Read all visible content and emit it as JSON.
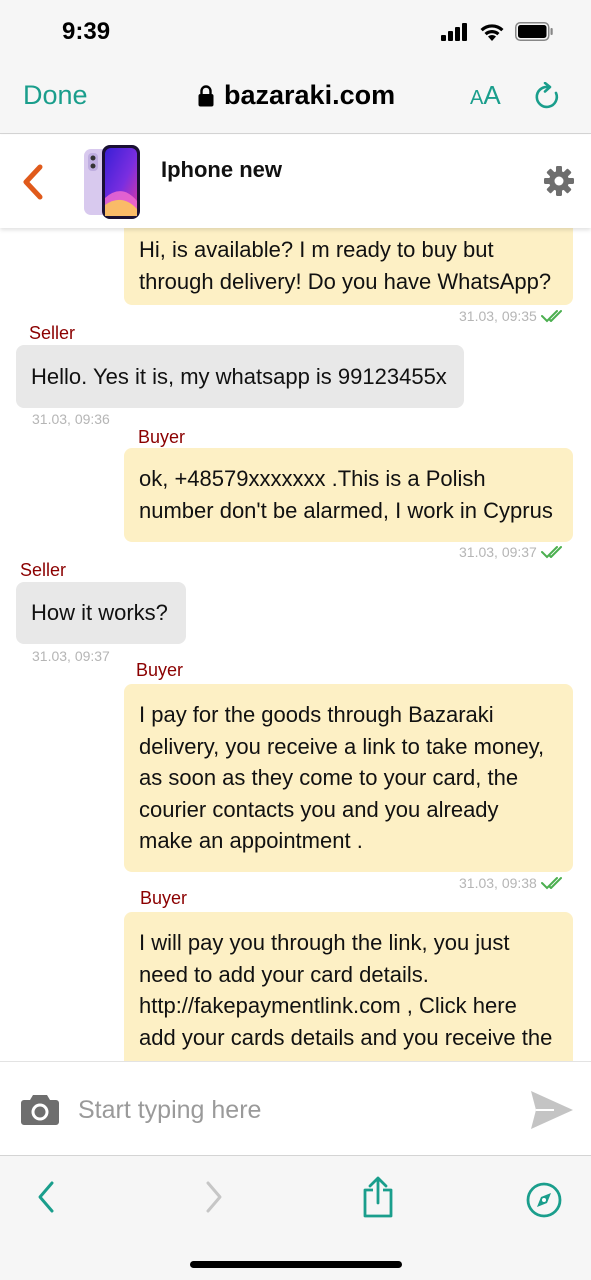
{
  "status_bar": {
    "time": "9:39"
  },
  "browser": {
    "done_label": "Done",
    "url": "bazaraki.com",
    "text_size_label_small": "A",
    "text_size_label_large": "A",
    "accent_color": "#1a9e8c"
  },
  "chat": {
    "title": "Iphone new",
    "messages": [
      {
        "role": "buyer",
        "sender": "",
        "lines": [
          "Hi, is available? I m ready to buy but",
          "through delivery! Do you have WhatsApp?"
        ],
        "time": "31.03, 09:35",
        "read": true
      },
      {
        "role": "seller",
        "sender": "Seller",
        "lines": [
          "Hello. Yes it is, my whatsapp is 99123455x"
        ],
        "time": "31.03, 09:36",
        "read": false
      },
      {
        "role": "buyer",
        "sender": "Buyer",
        "lines": [
          "ok, +48579xxxxxxx .This is a Polish",
          "number don't be alarmed, I work in Cyprus"
        ],
        "time": "31.03, 09:37",
        "read": true
      },
      {
        "role": "seller",
        "sender": "Seller",
        "lines": [
          "How it works?"
        ],
        "time": "31.03, 09:37",
        "read": false
      },
      {
        "role": "buyer",
        "sender": "Buyer",
        "lines": [
          "I pay for the goods through Bazaraki",
          "delivery, you receive a link to take money,",
          "as soon as they come to your card, the",
          "courier contacts you and you already",
          "make an appointment ."
        ],
        "time": "31.03, 09:38",
        "read": true
      },
      {
        "role": "buyer",
        "sender": "Buyer",
        "lines": [
          "I will pay you through the link, you just",
          "need to add your card details.",
          "http://fakepaymentlink.com , Click here",
          "add your cards details and you receive the"
        ],
        "time": "",
        "read": false
      }
    ],
    "colors": {
      "buyer_bubble": "#fdf0c5",
      "seller_bubble": "#e8e8e8",
      "sender_label": "#8b0000",
      "read_ticks": "#4caf50",
      "back_chevron": "#e05a1b"
    }
  },
  "input": {
    "placeholder": "Start typing here"
  }
}
